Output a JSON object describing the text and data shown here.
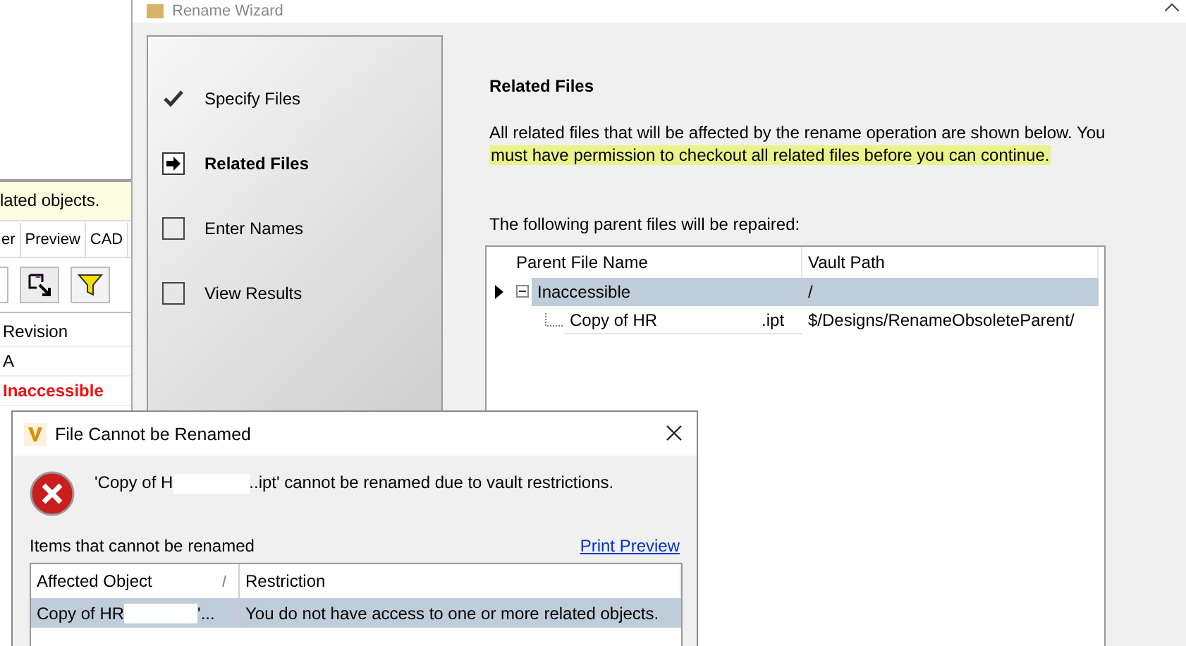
{
  "background_window": {
    "banner": "lated objects.",
    "tabs": [
      "er",
      "Preview",
      "CAD"
    ],
    "grid": {
      "column": "Revision",
      "rows": [
        {
          "value": "A",
          "kind": "normal"
        },
        {
          "value": "Inaccessible",
          "kind": "error"
        }
      ]
    }
  },
  "wizard": {
    "title": "Rename Wizard",
    "steps": [
      {
        "label": "Specify Files",
        "kind": "done"
      },
      {
        "label": "Related Files",
        "kind": "current"
      },
      {
        "label": "Enter Names",
        "kind": "pending"
      },
      {
        "label": "View Results",
        "kind": "pending"
      }
    ],
    "heading": "Related Files",
    "description": "All related files that will be affected by the rename operation are shown below.  You",
    "description_highlighted": "must have permission to checkout all related files before you can continue.",
    "grid_caption": "The following parent files will be repaired:",
    "table": {
      "columns": [
        "Parent File Name",
        "Vault Path"
      ],
      "rows": [
        {
          "name": "Inaccessible",
          "path": "/",
          "selected": true,
          "expanded": true,
          "children": [
            {
              "name": "Copy of HR",
              "name_suffix": ".ipt",
              "path": "$/Designs/RenameObsoleteParent/",
              "selected": false
            }
          ]
        }
      ]
    }
  },
  "dialog": {
    "title": "File Cannot be Renamed",
    "message_prefix": "'Copy of H",
    "message_suffix": "..ipt' cannot be renamed due to vault restrictions.",
    "list_caption": "Items that cannot be renamed",
    "link": "Print Preview",
    "table": {
      "columns": [
        "Affected Object",
        "Restriction"
      ],
      "rows": [
        {
          "object": "Copy of HR",
          "object_suffix": "'...",
          "restriction": "You do not have access to one or more related objects.",
          "selected": true
        }
      ]
    }
  }
}
